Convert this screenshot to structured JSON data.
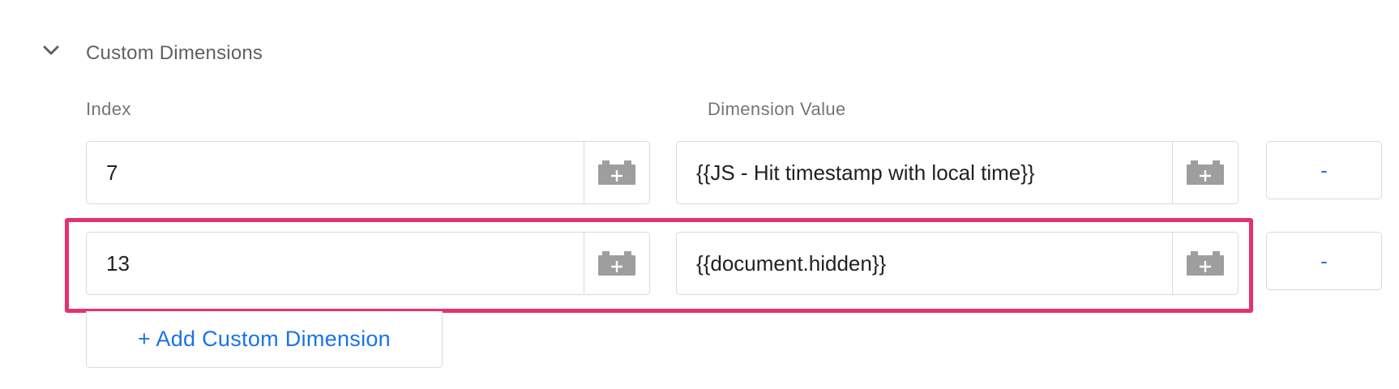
{
  "section": {
    "title": "Custom Dimensions",
    "chevron_icon": "chevron-down-icon"
  },
  "columns": {
    "index_label": "Index",
    "value_label": "Dimension Value"
  },
  "rows": [
    {
      "index": "7",
      "value": "{{JS - Hit timestamp with local time}}",
      "remove_label": "-"
    },
    {
      "index": "13",
      "value": "{{document.hidden}}",
      "remove_label": "-"
    }
  ],
  "variable_picker_icon": "add-variable-brick-icon",
  "add_button_label": "+ Add Custom Dimension",
  "colors": {
    "accent": "#1a73e8",
    "highlight": "#e8306f",
    "border": "#dadada",
    "icon": "#9e9e9e"
  }
}
